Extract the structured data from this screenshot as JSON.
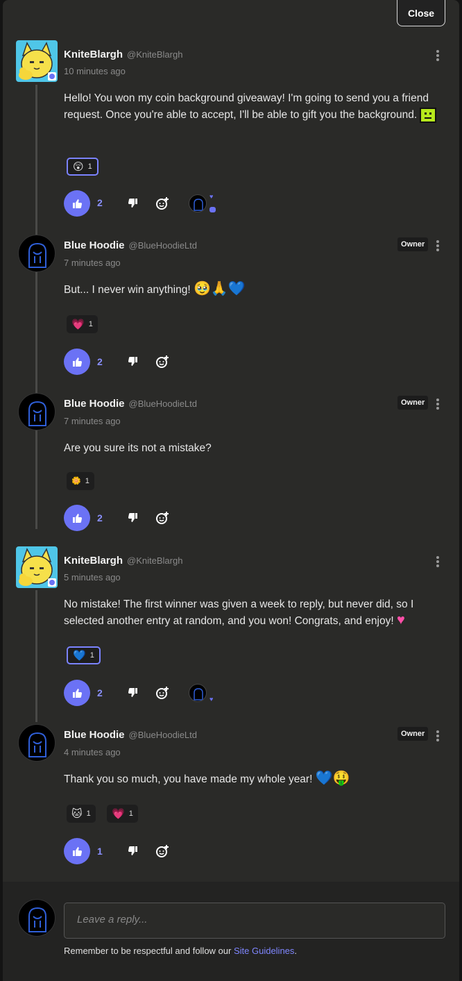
{
  "dialog": {
    "close_label": "Close"
  },
  "comments": [
    {
      "name": "KniteBlargh",
      "handle": "@KniteBlargh",
      "time": "10 minutes ago",
      "text": "Hello! You won my coin background giveaway! I'm going to send you a friend request. Once you're able to accept, I'll be able to gift you the background.",
      "reactions": [
        {
          "emoji": "😲",
          "count": "1"
        }
      ],
      "likes": "2"
    },
    {
      "name": "Blue Hoodie",
      "handle": "@BlueHoodieLtd",
      "time": "7 minutes ago",
      "badge": "Owner",
      "text": "But... I never win anything!",
      "text_emojis": "🥹🙏💙",
      "reactions": [
        {
          "emoji": "💗",
          "count": "1"
        }
      ],
      "likes": "2"
    },
    {
      "name": "Blue Hoodie",
      "handle": "@BlueHoodieLtd",
      "time": "7 minutes ago",
      "badge": "Owner",
      "text": "Are you sure its not a mistake?",
      "reactions": [
        {
          "emoji": "🌼",
          "count": "1"
        }
      ],
      "likes": "2"
    },
    {
      "name": "KniteBlargh",
      "handle": "@KniteBlargh",
      "time": "5 minutes ago",
      "text": "No mistake! The first winner was given a week to reply, but never did, so I selected another entry at random, and you won! Congrats, and enjoy!",
      "reactions": [
        {
          "emoji": "💙",
          "count": "1"
        }
      ],
      "likes": "2"
    },
    {
      "name": "Blue Hoodie",
      "handle": "@BlueHoodieLtd",
      "time": "4 minutes ago",
      "badge": "Owner",
      "text": "Thank you so much, you have made my whole year!",
      "text_emojis": "💙🤑",
      "reactions": [
        {
          "emoji": "🐱",
          "count": "1"
        },
        {
          "emoji": "💗",
          "count": "1"
        }
      ],
      "likes": "1"
    }
  ],
  "reply": {
    "placeholder": "Leave a reply...",
    "guidelines_text": "Remember to be respectful and follow our ",
    "guidelines_link": "Site Guidelines",
    "guidelines_end": "."
  },
  "colors": {
    "accent": "#6b72f5",
    "link": "#7f86ff",
    "panel": "#2a2a28"
  },
  "icons": [
    "thumbs-up-icon",
    "thumbs-down-icon",
    "add-reaction-icon",
    "more-options-icon"
  ]
}
